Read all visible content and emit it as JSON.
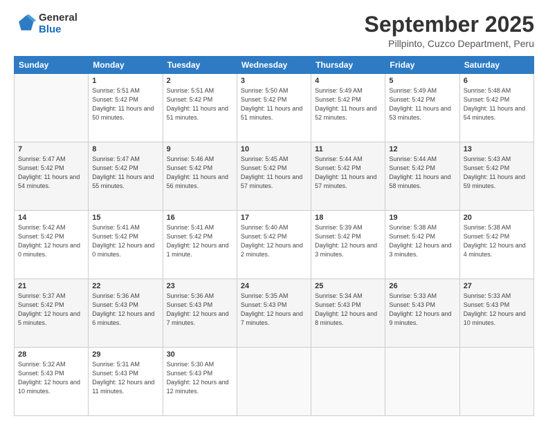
{
  "logo": {
    "general": "General",
    "blue": "Blue"
  },
  "header": {
    "month": "September 2025",
    "location": "Pillpinto, Cuzco Department, Peru"
  },
  "weekdays": [
    "Sunday",
    "Monday",
    "Tuesday",
    "Wednesday",
    "Thursday",
    "Friday",
    "Saturday"
  ],
  "weeks": [
    [
      {
        "day": "",
        "info": ""
      },
      {
        "day": "1",
        "info": "Sunrise: 5:51 AM\nSunset: 5:42 PM\nDaylight: 11 hours\nand 50 minutes."
      },
      {
        "day": "2",
        "info": "Sunrise: 5:51 AM\nSunset: 5:42 PM\nDaylight: 11 hours\nand 51 minutes."
      },
      {
        "day": "3",
        "info": "Sunrise: 5:50 AM\nSunset: 5:42 PM\nDaylight: 11 hours\nand 51 minutes."
      },
      {
        "day": "4",
        "info": "Sunrise: 5:49 AM\nSunset: 5:42 PM\nDaylight: 11 hours\nand 52 minutes."
      },
      {
        "day": "5",
        "info": "Sunrise: 5:49 AM\nSunset: 5:42 PM\nDaylight: 11 hours\nand 53 minutes."
      },
      {
        "day": "6",
        "info": "Sunrise: 5:48 AM\nSunset: 5:42 PM\nDaylight: 11 hours\nand 54 minutes."
      }
    ],
    [
      {
        "day": "7",
        "info": "Sunrise: 5:47 AM\nSunset: 5:42 PM\nDaylight: 11 hours\nand 54 minutes."
      },
      {
        "day": "8",
        "info": "Sunrise: 5:47 AM\nSunset: 5:42 PM\nDaylight: 11 hours\nand 55 minutes."
      },
      {
        "day": "9",
        "info": "Sunrise: 5:46 AM\nSunset: 5:42 PM\nDaylight: 11 hours\nand 56 minutes."
      },
      {
        "day": "10",
        "info": "Sunrise: 5:45 AM\nSunset: 5:42 PM\nDaylight: 11 hours\nand 57 minutes."
      },
      {
        "day": "11",
        "info": "Sunrise: 5:44 AM\nSunset: 5:42 PM\nDaylight: 11 hours\nand 57 minutes."
      },
      {
        "day": "12",
        "info": "Sunrise: 5:44 AM\nSunset: 5:42 PM\nDaylight: 11 hours\nand 58 minutes."
      },
      {
        "day": "13",
        "info": "Sunrise: 5:43 AM\nSunset: 5:42 PM\nDaylight: 11 hours\nand 59 minutes."
      }
    ],
    [
      {
        "day": "14",
        "info": "Sunrise: 5:42 AM\nSunset: 5:42 PM\nDaylight: 12 hours\nand 0 minutes."
      },
      {
        "day": "15",
        "info": "Sunrise: 5:41 AM\nSunset: 5:42 PM\nDaylight: 12 hours\nand 0 minutes."
      },
      {
        "day": "16",
        "info": "Sunrise: 5:41 AM\nSunset: 5:42 PM\nDaylight: 12 hours\nand 1 minute."
      },
      {
        "day": "17",
        "info": "Sunrise: 5:40 AM\nSunset: 5:42 PM\nDaylight: 12 hours\nand 2 minutes."
      },
      {
        "day": "18",
        "info": "Sunrise: 5:39 AM\nSunset: 5:42 PM\nDaylight: 12 hours\nand 3 minutes."
      },
      {
        "day": "19",
        "info": "Sunrise: 5:38 AM\nSunset: 5:42 PM\nDaylight: 12 hours\nand 3 minutes."
      },
      {
        "day": "20",
        "info": "Sunrise: 5:38 AM\nSunset: 5:42 PM\nDaylight: 12 hours\nand 4 minutes."
      }
    ],
    [
      {
        "day": "21",
        "info": "Sunrise: 5:37 AM\nSunset: 5:42 PM\nDaylight: 12 hours\nand 5 minutes."
      },
      {
        "day": "22",
        "info": "Sunrise: 5:36 AM\nSunset: 5:43 PM\nDaylight: 12 hours\nand 6 minutes."
      },
      {
        "day": "23",
        "info": "Sunrise: 5:36 AM\nSunset: 5:43 PM\nDaylight: 12 hours\nand 7 minutes."
      },
      {
        "day": "24",
        "info": "Sunrise: 5:35 AM\nSunset: 5:43 PM\nDaylight: 12 hours\nand 7 minutes."
      },
      {
        "day": "25",
        "info": "Sunrise: 5:34 AM\nSunset: 5:43 PM\nDaylight: 12 hours\nand 8 minutes."
      },
      {
        "day": "26",
        "info": "Sunrise: 5:33 AM\nSunset: 5:43 PM\nDaylight: 12 hours\nand 9 minutes."
      },
      {
        "day": "27",
        "info": "Sunrise: 5:33 AM\nSunset: 5:43 PM\nDaylight: 12 hours\nand 10 minutes."
      }
    ],
    [
      {
        "day": "28",
        "info": "Sunrise: 5:32 AM\nSunset: 5:43 PM\nDaylight: 12 hours\nand 10 minutes."
      },
      {
        "day": "29",
        "info": "Sunrise: 5:31 AM\nSunset: 5:43 PM\nDaylight: 12 hours\nand 11 minutes."
      },
      {
        "day": "30",
        "info": "Sunrise: 5:30 AM\nSunset: 5:43 PM\nDaylight: 12 hours\nand 12 minutes."
      },
      {
        "day": "",
        "info": ""
      },
      {
        "day": "",
        "info": ""
      },
      {
        "day": "",
        "info": ""
      },
      {
        "day": "",
        "info": ""
      }
    ]
  ]
}
